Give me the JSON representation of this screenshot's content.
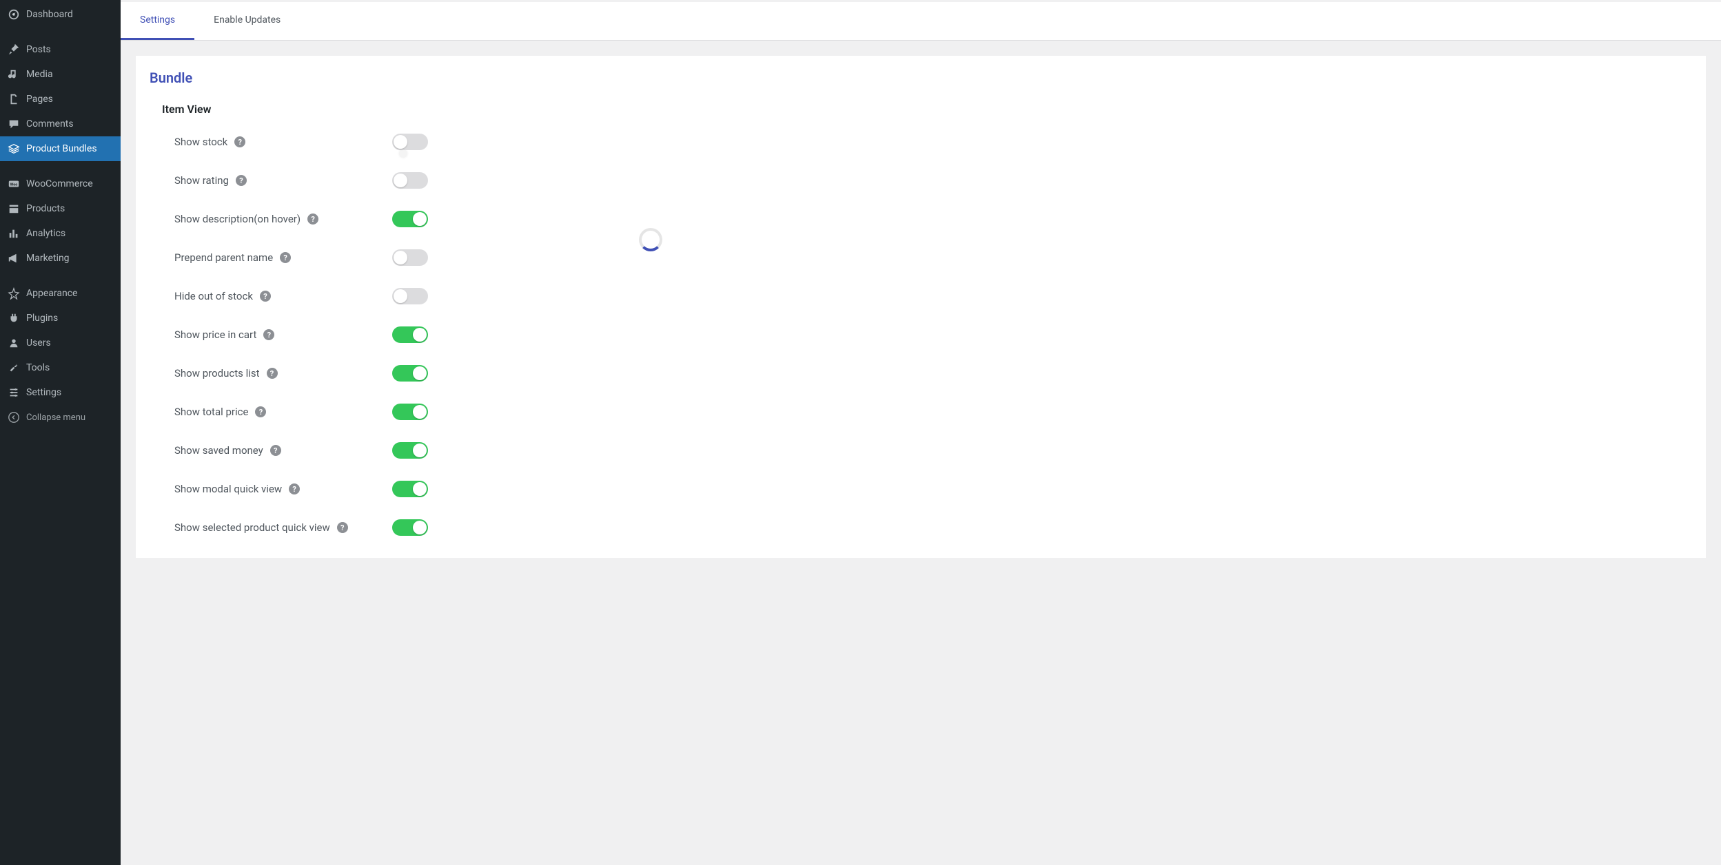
{
  "sidebar": {
    "items": [
      {
        "label": "Dashboard",
        "icon": "dashboard-icon"
      },
      {
        "label": "Posts",
        "icon": "pin-icon"
      },
      {
        "label": "Media",
        "icon": "media-icon"
      },
      {
        "label": "Pages",
        "icon": "page-icon"
      },
      {
        "label": "Comments",
        "icon": "comment-icon"
      },
      {
        "label": "Product Bundles",
        "icon": "layers-icon",
        "active": true
      },
      {
        "label": "WooCommerce",
        "icon": "woo-icon"
      },
      {
        "label": "Products",
        "icon": "products-icon"
      },
      {
        "label": "Analytics",
        "icon": "analytics-icon"
      },
      {
        "label": "Marketing",
        "icon": "marketing-icon"
      },
      {
        "label": "Appearance",
        "icon": "appearance-icon"
      },
      {
        "label": "Plugins",
        "icon": "plugins-icon"
      },
      {
        "label": "Users",
        "icon": "users-icon"
      },
      {
        "label": "Tools",
        "icon": "tools-icon"
      },
      {
        "label": "Settings",
        "icon": "settings-icon"
      }
    ],
    "collapse_label": "Collapse menu"
  },
  "tabs": [
    {
      "label": "Settings",
      "active": true
    },
    {
      "label": "Enable Updates",
      "active": false
    }
  ],
  "section_title": "Bundle",
  "subsection_title": "Item View",
  "settings": [
    {
      "label": "Show stock",
      "on": false
    },
    {
      "label": "Show rating",
      "on": false
    },
    {
      "label": "Show description(on hover)",
      "on": true
    },
    {
      "label": "Prepend parent name",
      "on": false
    },
    {
      "label": "Hide out of stock",
      "on": false
    },
    {
      "label": "Show price in cart",
      "on": true
    },
    {
      "label": "Show products list",
      "on": true
    },
    {
      "label": "Show total price",
      "on": true
    },
    {
      "label": "Show saved money",
      "on": true
    },
    {
      "label": "Show modal quick view",
      "on": true
    },
    {
      "label": "Show selected product quick view",
      "on": true
    }
  ]
}
